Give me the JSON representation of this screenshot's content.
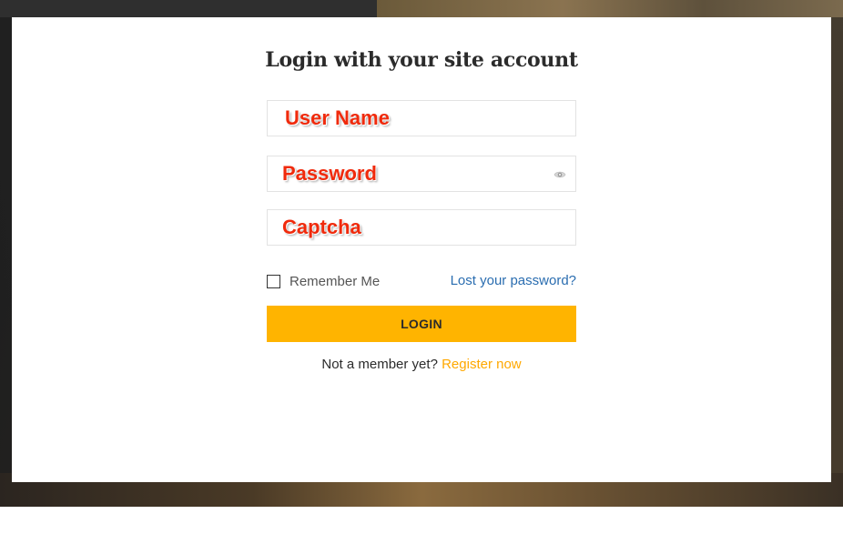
{
  "modal": {
    "title": "Login with your site account"
  },
  "form": {
    "username": {
      "overlay_label": "User Name",
      "value": ""
    },
    "password": {
      "overlay_label": "Password",
      "value": "",
      "toggle_icon": "eye-icon"
    },
    "captcha": {
      "overlay_label": "Captcha",
      "value": ""
    },
    "remember_label": "Remember Me",
    "remember_checked": false,
    "lost_password_link": "Lost your password?",
    "login_button": "LOGIN",
    "not_member_text": "Not a member yet?",
    "register_link": "Register now"
  },
  "colors": {
    "accent": "#ffb400",
    "link_blue": "#2a6db0",
    "register_orange": "#ffa800",
    "annotation_red": "#f02a0c"
  }
}
